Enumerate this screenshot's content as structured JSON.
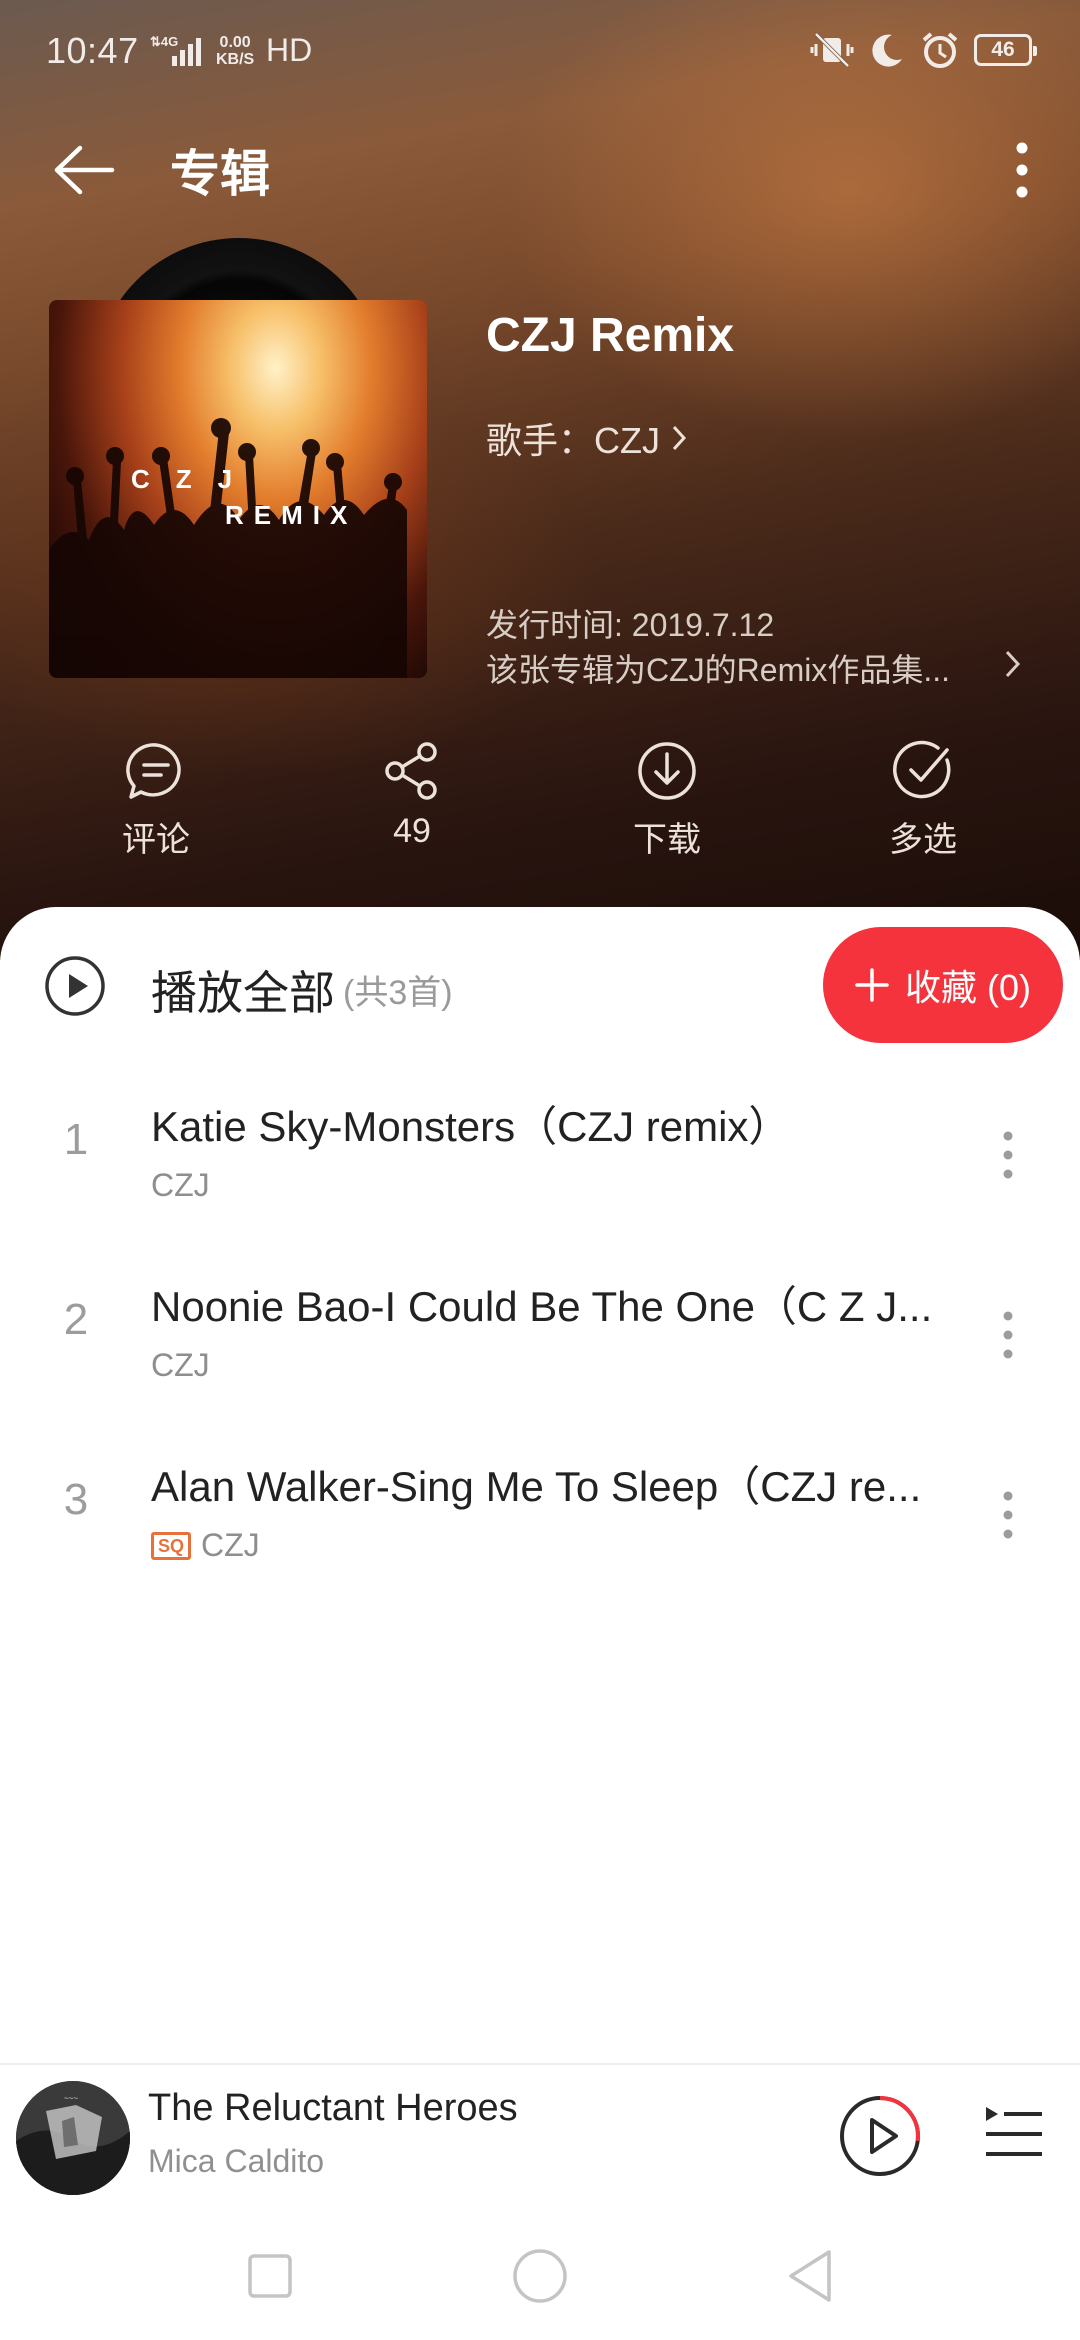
{
  "status_bar": {
    "time": "10:47",
    "speed_value": "0.00",
    "speed_unit": "KB/S",
    "hd": "HD",
    "battery": "46"
  },
  "header": {
    "title": "专辑"
  },
  "album": {
    "cover_text_line1": "CZJ",
    "cover_text_line2": "REMIX",
    "title": "CZJ Remix",
    "artist": "歌手：CZJ",
    "release_date": "发行时间: 2019.7.12",
    "description": "该张专辑为CZJ的Remix作品集..."
  },
  "actions": [
    {
      "label": "评论",
      "icon": "comment-icon"
    },
    {
      "label": "49",
      "icon": "share-icon"
    },
    {
      "label": "下载",
      "icon": "download-icon"
    },
    {
      "label": "多选",
      "icon": "multi-select-icon"
    }
  ],
  "playlist": {
    "play_all_label": "播放全部",
    "count_label": "(共3首)",
    "collect_label": "收藏 (0)",
    "tracks": [
      {
        "number": "1",
        "title": "Katie Sky-Monsters（CZJ remix）",
        "artist": "CZJ",
        "badge": ""
      },
      {
        "number": "2",
        "title": "Noonie Bao-I Could Be The One（C Z J...",
        "artist": "CZJ",
        "badge": ""
      },
      {
        "number": "3",
        "title": "Alan Walker-Sing Me To Sleep（CZJ re...",
        "artist": "CZJ",
        "badge": "SQ"
      }
    ]
  },
  "mini_player": {
    "title": "The Reluctant Heroes",
    "artist": "Mica Caldito",
    "progress": 0.27
  },
  "colors": {
    "accent": "#f4333d",
    "badge": "#e8703a"
  }
}
